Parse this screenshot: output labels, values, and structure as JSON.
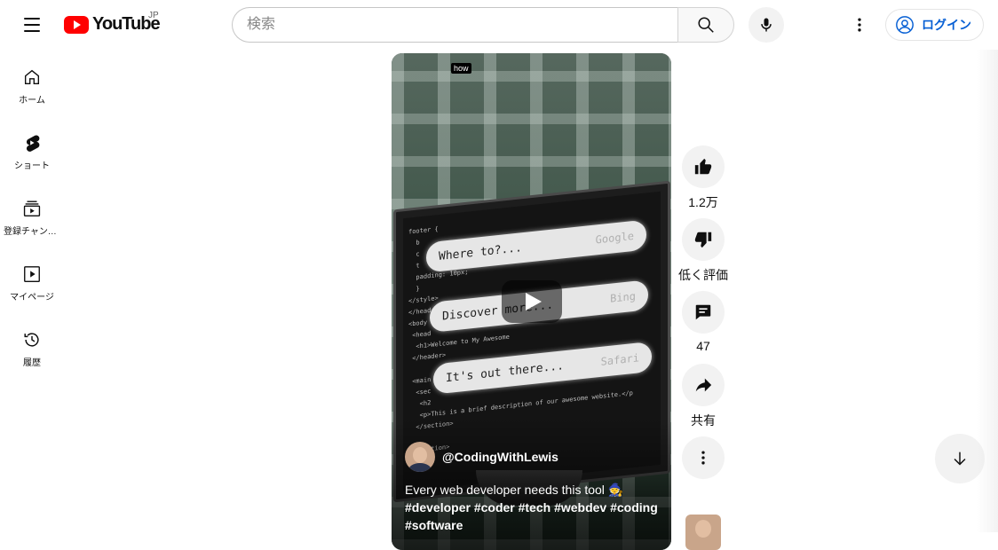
{
  "header": {
    "logo_text": "YouTube",
    "region": "JP",
    "search_placeholder": "検索",
    "login_label": "ログイン",
    "icons": [
      "menu-icon",
      "search-icon",
      "mic-icon",
      "more-vert-icon",
      "account-icon"
    ]
  },
  "sidebar": {
    "items": [
      {
        "label": "ホーム",
        "icon": "home-icon"
      },
      {
        "label": "ショート",
        "icon": "shorts-icon"
      },
      {
        "label": "登録チャンネル",
        "icon": "subscriptions-icon"
      },
      {
        "label": "マイページ",
        "icon": "library-icon"
      },
      {
        "label": "履歴",
        "icon": "history-icon"
      }
    ]
  },
  "video": {
    "overlay_tag": "how",
    "screen_pills": [
      {
        "text": "Where to?...",
        "brand": "Google"
      },
      {
        "text": "Discover more...",
        "brand": "Bing"
      },
      {
        "text": "It's out there...",
        "brand": "Safari"
      }
    ],
    "channel_name": "@CodingWithLewis",
    "caption_text": "Every web developer needs this tool 🧙",
    "hashtags": "#developer #coder #tech #webdev #coding #software"
  },
  "actions": {
    "like_count": "1.2万",
    "dislike_label": "低く評価",
    "comment_count": "47",
    "share_label": "共有"
  },
  "colors": {
    "brand_red": "#ff0000",
    "link_blue": "#065fd4",
    "button_bg": "#f2f2f2"
  }
}
